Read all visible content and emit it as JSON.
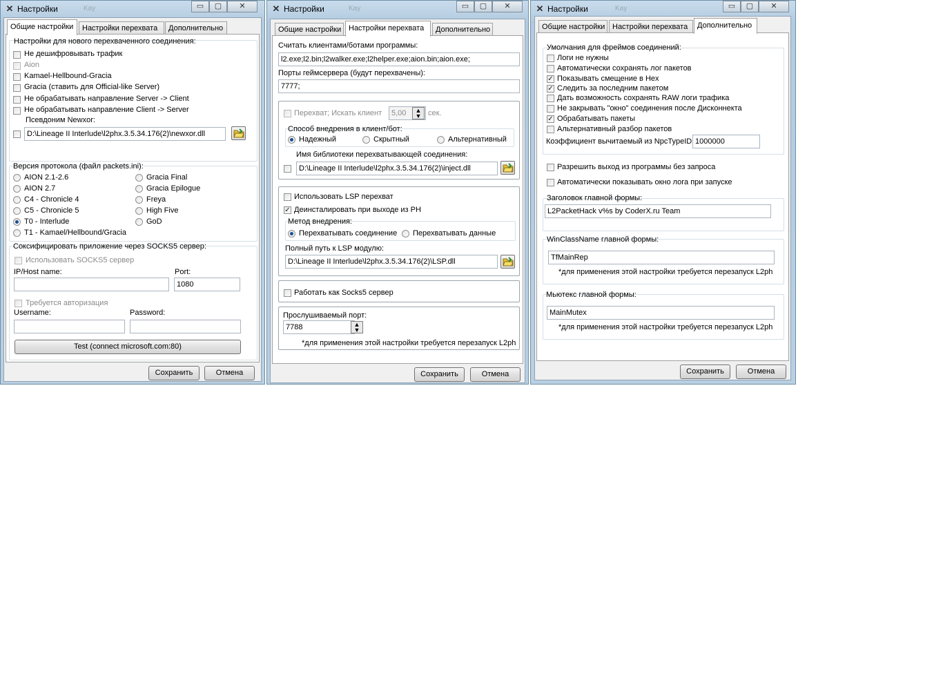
{
  "ghost_title": "Kay",
  "window_title": "Настройки",
  "win_buttons": {
    "minimize": "▭",
    "maximize": "▢",
    "close": "✕"
  },
  "tabs": [
    "Общие настройки",
    "Настройки перехвата",
    "Дополнительно"
  ],
  "buttons": {
    "save": "Сохранить",
    "cancel": "Отмена"
  },
  "general": {
    "new_conn_title": "Настройки для нового перехваченного соединения:",
    "checks": [
      {
        "label": "Не дешифровывать трафик",
        "checked": false,
        "disabled": false
      },
      {
        "label": "Aion",
        "checked": false,
        "disabled": true
      },
      {
        "label": "Kamael-Hellbound-Gracia",
        "checked": false,
        "disabled": false
      },
      {
        "label": "Gracia (ставить для Official-like Server)",
        "checked": false,
        "disabled": false
      },
      {
        "label": "Не обрабатывать направление Server -> Client",
        "checked": false,
        "disabled": false
      },
      {
        "label": "Не обрабатывать направление Client -> Server",
        "checked": false,
        "disabled": false
      }
    ],
    "alias_label": "Псевдоним Newxor:",
    "newxor_path": "D:\\Lineage II Interlude\\l2phx.3.5.34.176(2)\\newxor.dll",
    "protocol_title": "Версия протокола (файл packets.ini):",
    "protocols_left": [
      {
        "label": "AION 2.1-2.6",
        "selected": false
      },
      {
        "label": "AION 2.7",
        "selected": false
      },
      {
        "label": "C4 - Chronicle 4",
        "selected": false
      },
      {
        "label": "C5 - Chronicle 5",
        "selected": false
      },
      {
        "label": "T0 - Interlude",
        "selected": true
      },
      {
        "label": "T1 - Kamael/Hellbound/Gracia",
        "selected": false
      }
    ],
    "protocols_right": [
      {
        "label": "Gracia Final",
        "selected": false
      },
      {
        "label": "Gracia Epilogue",
        "selected": false
      },
      {
        "label": "Freya",
        "selected": false
      },
      {
        "label": "High Five",
        "selected": false
      },
      {
        "label": "GoD",
        "selected": false
      }
    ],
    "socks_title": "Соксифицировать приложение через SOCKS5 сервер:",
    "use_socks": "Использовать SOCKS5 сервер",
    "host_label": "IP/Host name:",
    "host_value": "",
    "port_label": "Port:",
    "port_value": "1080",
    "auth_label": "Требуется авторизация",
    "username_label": "Username:",
    "username_value": "",
    "password_label": "Password:",
    "password_value": "",
    "test_button": "Test (connect microsoft.com:80)"
  },
  "intercept": {
    "clients_label": "Считать клиентами/ботами программы:",
    "clients_value": "l2.exe;l2.bin;l2walker.exe;l2helper.exe;aion.bin;aion.exe;",
    "ports_label": "Порты геймсервера (будут перехвачены):",
    "ports_value": "7777;",
    "intercept_label": "Перехват;  Искать клиент",
    "intercept_interval": "5,00",
    "sec_label": "сек.",
    "inject_method_title": "Способ внедрения в клиент/бот:",
    "inject_methods": [
      {
        "label": "Надежный",
        "selected": true
      },
      {
        "label": "Скрытный",
        "selected": false
      },
      {
        "label": "Альтернативный",
        "selected": false
      }
    ],
    "lib_label": "Имя библиотеки перехватывающей соединения:",
    "lib_path": "D:\\Lineage II Interlude\\l2phx.3.5.34.176(2)\\inject.dll",
    "use_lsp": "Использовать LSP перехват",
    "uninstall_lsp": "Деинсталировать при выходе из PH",
    "lsp_method_title": "Метод внедрения:",
    "lsp_methods": [
      {
        "label": "Перехватывать соединение",
        "selected": true
      },
      {
        "label": "Перехватывать данные",
        "selected": false
      }
    ],
    "lsp_path_label": "Полный путь к LSP модулю:",
    "lsp_path": "D:\\Lineage II Interlude\\l2phx.3.5.34.176(2)\\LSP.dll",
    "socks5_server": "Работать как Socks5 сервер",
    "listen_port_label": "Прослушиваемый порт:",
    "listen_port": "7788",
    "restart_note": "*для применения этой настройки требуется перезапуск L2ph"
  },
  "advanced": {
    "defaults_title": "Умолчания для фреймов соединений:",
    "checks": [
      {
        "label": "Логи не нужны",
        "checked": false
      },
      {
        "label": "Автоматически сохранять лог пакетов",
        "checked": false
      },
      {
        "label": "Показывать смещение в Hex",
        "checked": true
      },
      {
        "label": "Следить за последним пакетом",
        "checked": true
      },
      {
        "label": "Дать возможность сохранять RAW логи трафика",
        "checked": false
      },
      {
        "label": "Не закрывать \"окно\" соединения после Дисконнекта",
        "checked": false
      },
      {
        "label": "Обрабатывать пакеты",
        "checked": true
      },
      {
        "label": "Альтернативный разбор пакетов",
        "checked": false
      }
    ],
    "npc_coef_label": "Коэффициент вычитаемый из NpcTypeID",
    "npc_coef_value": "1000000",
    "allow_exit": "Разрешить выход из программы без запроса",
    "auto_log": "Автоматически показывать окно лога при запуске",
    "main_title_label": "Заголовок главной формы:",
    "main_title_value": "L2PacketHack v%s by CoderX.ru Team",
    "winclass_label": "WinClassName главной формы:",
    "winclass_value": "TfMainRep",
    "mutex_label": "Мьютекс главной формы:",
    "mutex_value": "MainMutex",
    "restart_note": "*для применения этой настройки требуется перезапуск L2ph"
  }
}
